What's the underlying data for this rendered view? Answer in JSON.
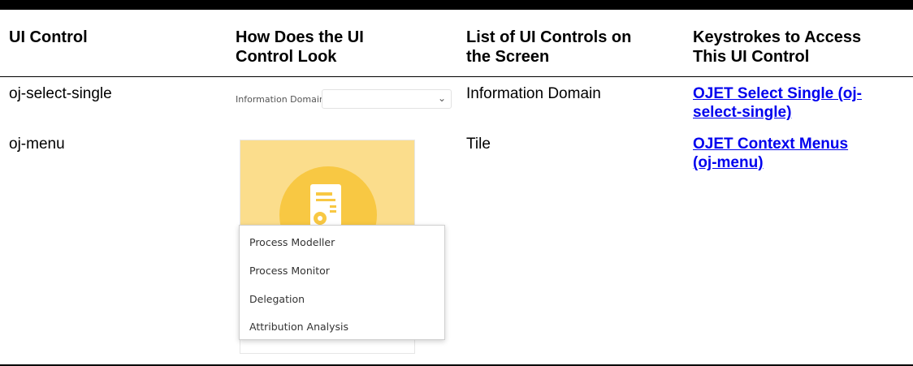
{
  "table": {
    "headers": {
      "col1": "UI Control",
      "col2_line1": "How Does the UI",
      "col2_line2": "Control Look",
      "col3_line1": "List of UI Controls on",
      "col3_line2": "the Screen",
      "col4_line1": "Keystrokes to Access",
      "col4_line2": "This UI Control"
    },
    "rows": [
      {
        "control": "oj-select-single",
        "list_item": "Information Domain",
        "link_line1": "OJET Select Single (oj-",
        "link_line2": "select-single)",
        "preview": {
          "label": "Information Domain",
          "chevron": "⌄",
          "chevron_icon": "chevron-down-icon"
        }
      },
      {
        "control": "oj-menu",
        "list_item": "Tile",
        "link_line1": "OJET Context Menus",
        "link_line2": "(oj-menu)",
        "preview": {
          "icon": "document-gear-icon",
          "tile_color": "#fbdd8c",
          "circle_color": "#f8c843",
          "menu_items": [
            "Process Modeller",
            "Process Monitor",
            "Delegation",
            "Attribution Analysis"
          ]
        }
      }
    ]
  },
  "colors": {
    "link": "#0000ee",
    "rule": "#000000"
  }
}
